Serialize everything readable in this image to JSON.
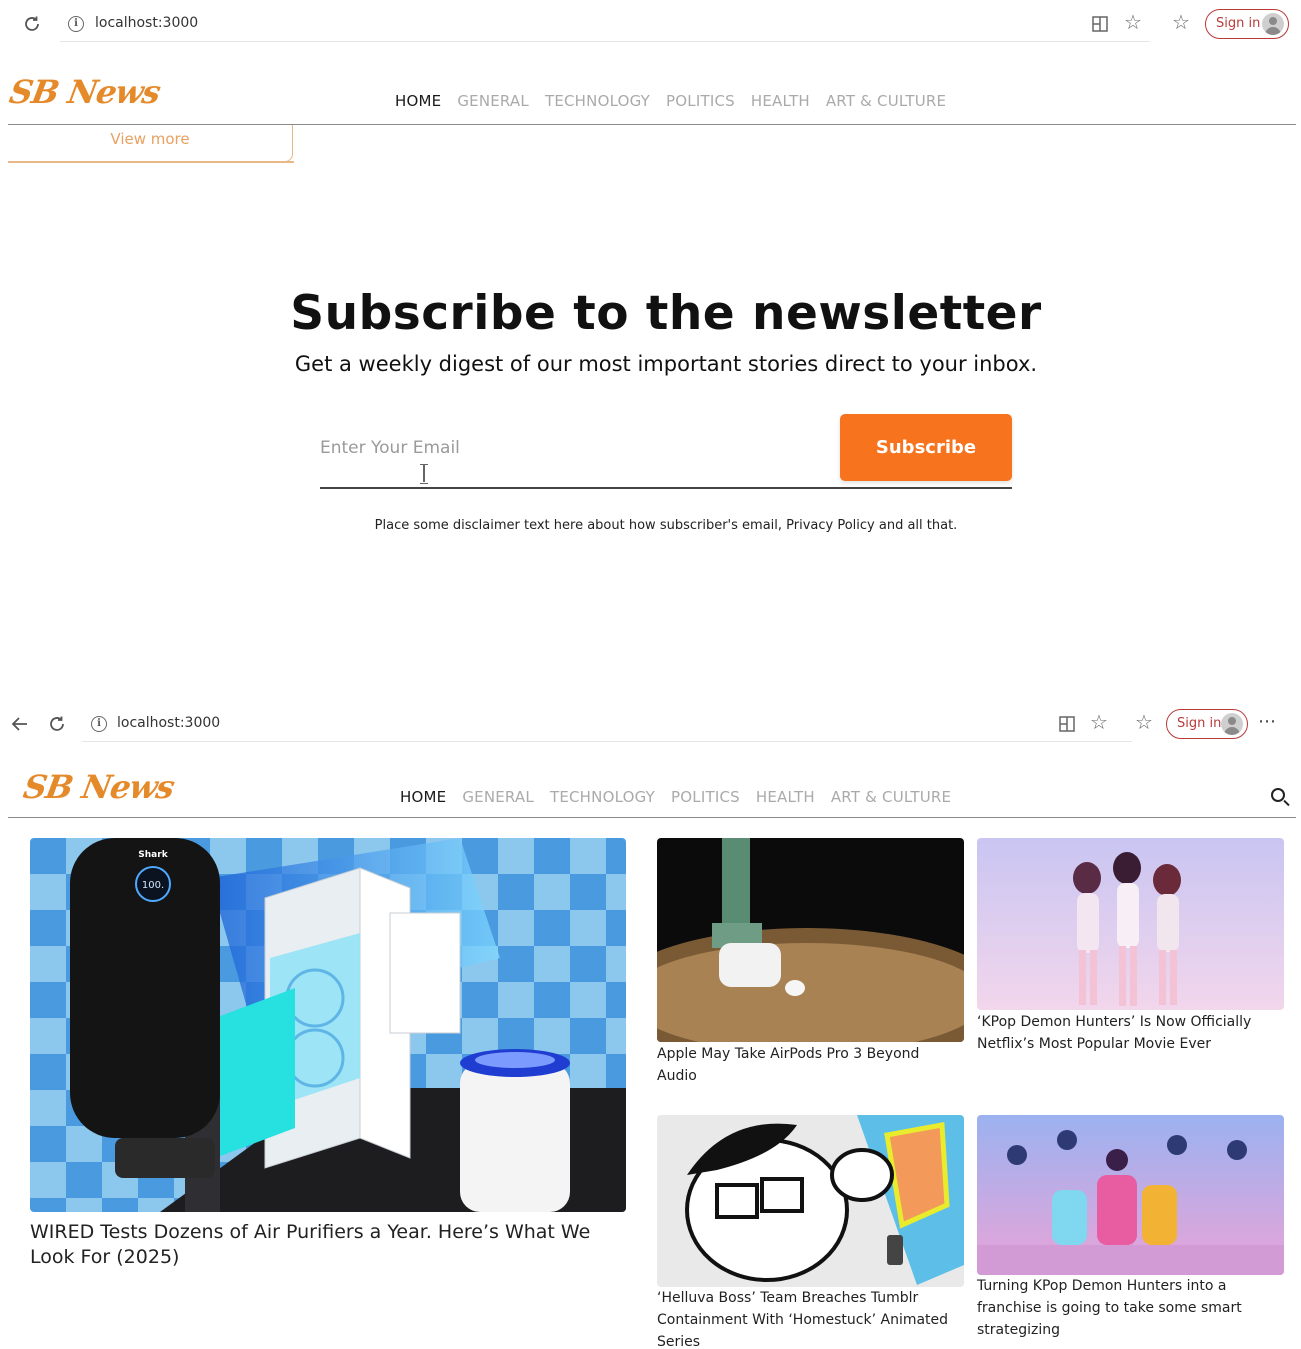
{
  "browser": {
    "url": "localhost:3000",
    "signin_label": "Sign in",
    "more_glyph": "⋯"
  },
  "site": {
    "logo": "SB News",
    "nav": [
      "HOME",
      "GENERAL",
      "TECHNOLOGY",
      "POLITICS",
      "HEALTH",
      "ART & CULTURE"
    ],
    "active_nav": "HOME",
    "accent_color": "#f7731d",
    "logo_color": "#e58a2a"
  },
  "section1": {
    "view_more": "View more",
    "newsletter": {
      "title": "Subscribe to the newsletter",
      "subtitle": "Get a weekly digest of our most important stories direct to your inbox.",
      "email_placeholder": "Enter Your Email",
      "button": "Subscribe",
      "disclaimer": "Place some disclaimer text here about how subscriber's email, Privacy Policy and all that."
    }
  },
  "section2": {
    "hero": {
      "title": "WIRED Tests Dozens of Air Purifiers a Year. Here’s What We Look For (2025)",
      "brand": "Shark",
      "display": "100."
    },
    "articles": [
      {
        "title": "Apple May Take AirPods Pro 3 Beyond Audio"
      },
      {
        "title": "‘KPop Demon Hunters’ Is Now Officially Netflix’s Most Popular Movie Ever"
      },
      {
        "title": "‘Helluva Boss’ Team Breaches Tumblr Containment With ‘Homestuck’ Animated Series"
      },
      {
        "title": "Turning KPop Demon Hunters into a franchise is going to take some smart strategizing"
      }
    ]
  }
}
